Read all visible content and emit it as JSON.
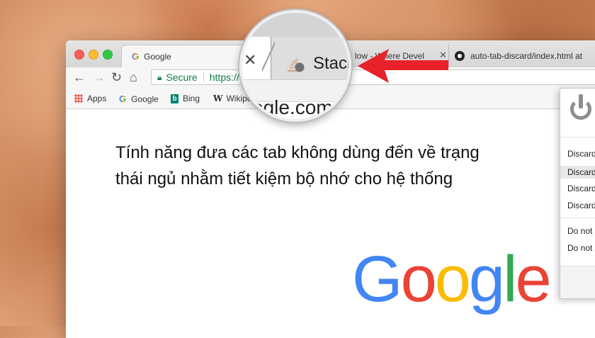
{
  "browser": {
    "tabs": [
      {
        "label": "Google",
        "favicon": "google-g-icon",
        "active": true
      },
      {
        "label": "low - Where Devel",
        "favicon": "none",
        "active": false
      },
      {
        "label": "auto-tab-discard/index.html at",
        "favicon": "github-icon",
        "active": false
      }
    ],
    "tab_close_glyph": "✕",
    "omnibox": {
      "secure_label": "Secure",
      "url": "https://"
    },
    "bookmarks": [
      {
        "label": "Apps",
        "icon": "apps-grid-icon"
      },
      {
        "label": "Google",
        "icon": "google-g-icon"
      },
      {
        "label": "Bing",
        "icon": "bing-icon"
      },
      {
        "label": "Wikipe",
        "icon": "wikipedia-icon"
      }
    ]
  },
  "page": {
    "caption_line1": "Tính năng đưa các tab không dùng đến về trạng",
    "caption_line2": "thái ngủ nhằm tiết kiệm bộ nhớ cho hệ thống",
    "google_logo": {
      "letters": [
        "G",
        "o",
        "o",
        "g",
        "l",
        "e"
      ],
      "colors": [
        "#4285f4",
        "#ea4335",
        "#fbbc05",
        "#4285f4",
        "#34a853",
        "#ea4335"
      ]
    }
  },
  "extension_popup": {
    "items": [
      "Discard",
      "Discard",
      "Discard",
      "Discard",
      "Do not",
      "Do not"
    ],
    "highlighted_index": 1,
    "icon": "power-icon"
  },
  "magnifier": {
    "tab_text": "Stacl",
    "close_glyph": "✕",
    "bookmark_glyph": "W",
    "url_fragment": "ogle.com"
  },
  "annotation": {
    "arrow_color": "#e8222a"
  }
}
